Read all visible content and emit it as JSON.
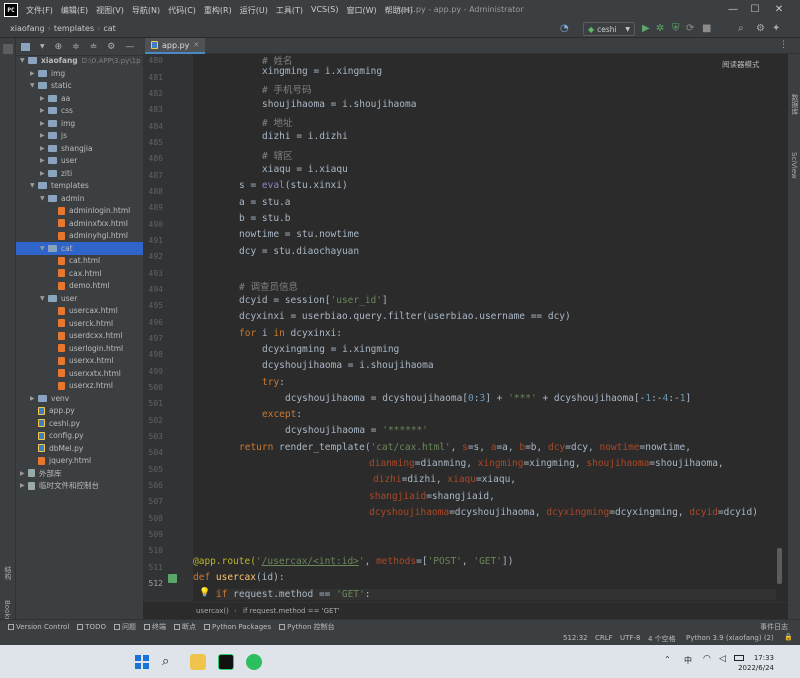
{
  "titlebar": {
    "menu": [
      "文件(F)",
      "编辑(E)",
      "视图(V)",
      "导航(N)",
      "代码(C)",
      "重构(R)",
      "运行(U)",
      "工具(T)",
      "VCS(S)",
      "窗口(W)",
      "帮助(H)"
    ],
    "window_title": "test.py - app.py - Administrator"
  },
  "navbar": {
    "breadcrumbs": [
      "xiaofang",
      "templates",
      "cat"
    ],
    "run_config": "ceshi"
  },
  "project": {
    "items": [
      {
        "label": "xiaofang",
        "path": "D:\\0.APP\\3.py\\1p",
        "type": "folder",
        "open": true
      },
      {
        "label": "img",
        "type": "folder",
        "open": false
      },
      {
        "label": "static",
        "type": "folder",
        "open": true
      },
      {
        "label": "aa",
        "type": "folder",
        "open": false
      },
      {
        "label": "css",
        "type": "folder",
        "open": false
      },
      {
        "label": "img",
        "type": "folder",
        "open": false
      },
      {
        "label": "js",
        "type": "folder",
        "open": false
      },
      {
        "label": "shangjia",
        "type": "folder",
        "open": false
      },
      {
        "label": "user",
        "type": "folder",
        "open": false
      },
      {
        "label": "ziti",
        "type": "folder",
        "open": false
      },
      {
        "label": "templates",
        "type": "folder",
        "open": true
      },
      {
        "label": "admin",
        "type": "folder",
        "open": true
      },
      {
        "label": "adminlogin.html",
        "type": "html"
      },
      {
        "label": "adminxfxx.html",
        "type": "html"
      },
      {
        "label": "adminyhgl.html",
        "type": "html"
      },
      {
        "label": "cat",
        "type": "folder",
        "open": true,
        "selected": true
      },
      {
        "label": "cat.html",
        "type": "html"
      },
      {
        "label": "cax.html",
        "type": "html"
      },
      {
        "label": "demo.html",
        "type": "html"
      },
      {
        "label": "user",
        "type": "folder",
        "open": true
      },
      {
        "label": "usercax.html",
        "type": "html"
      },
      {
        "label": "userck.html",
        "type": "html"
      },
      {
        "label": "userdcxx.html",
        "type": "html"
      },
      {
        "label": "userlogin.html",
        "type": "html"
      },
      {
        "label": "userxx.html",
        "type": "html"
      },
      {
        "label": "userxxtx.html",
        "type": "html"
      },
      {
        "label": "userxz.html",
        "type": "html"
      },
      {
        "label": "venv",
        "type": "folder",
        "open": false
      },
      {
        "label": "app.py",
        "type": "py"
      },
      {
        "label": "ceshi.py",
        "type": "py"
      },
      {
        "label": "config.py",
        "type": "py"
      },
      {
        "label": "dbMel.py",
        "type": "py"
      },
      {
        "label": "jquery.html",
        "type": "html"
      },
      {
        "label": "外部库",
        "type": "lib",
        "open": false
      },
      {
        "label": "临时文件和控制台",
        "type": "lib",
        "open": false
      }
    ]
  },
  "tabs": [
    {
      "label": "app.py"
    }
  ],
  "editor": {
    "read_mode": "阅读器模式",
    "line_numbers": [
      "480",
      "481",
      "482",
      "483",
      "484",
      "485",
      "486",
      "487",
      "488",
      "489",
      "490",
      "491",
      "492",
      "493",
      "494",
      "495",
      "496",
      "497",
      "498",
      "499",
      "500",
      "501",
      "502",
      "503",
      "504",
      "505",
      "506",
      "507",
      "508",
      "509",
      "510",
      "511",
      "512"
    ]
  },
  "code_breadcrumbs": [
    "usercax()",
    "if request.method == 'GET'"
  ],
  "left_stripe": {
    "structure": "结构",
    "bookmarks": "Bookmarks"
  },
  "right_stripe": {
    "database": "数据库",
    "sciview": "SciView"
  },
  "bottom_tools": [
    "Version Control",
    "TODO",
    "问题",
    "终端",
    "断点",
    "Python Packages",
    "Python 控制台"
  ],
  "event_log": "事件日志",
  "status": {
    "position": "512:32",
    "line_sep": "CRLF",
    "encoding": "UTF-8",
    "indent": "4 个空格",
    "interpreter": "Python 3.9 (xiaofang) (2)"
  },
  "taskbar": {
    "ime": "中",
    "time": "17:33",
    "date": "2022/6/24"
  }
}
